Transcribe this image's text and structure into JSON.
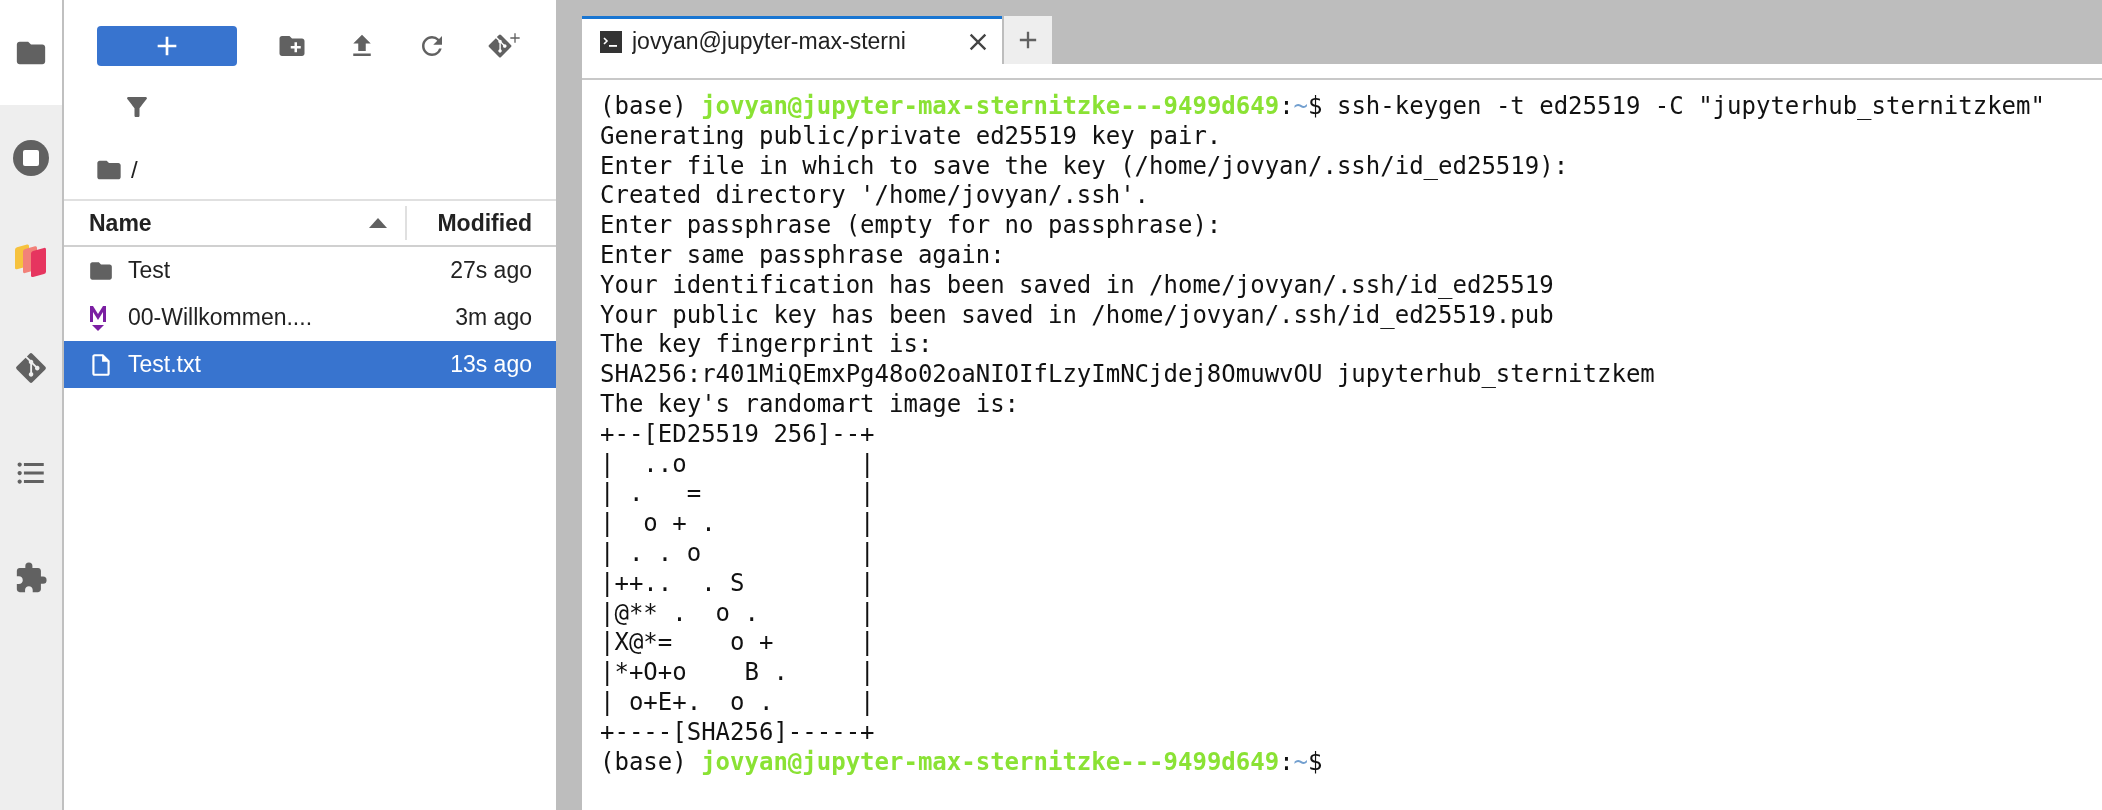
{
  "activity_bar": {
    "items": [
      {
        "kind": "folder",
        "selected": true
      },
      {
        "kind": "running",
        "selected": false
      },
      {
        "kind": "palette",
        "selected": false
      },
      {
        "kind": "git",
        "selected": false
      },
      {
        "kind": "toc",
        "selected": false
      },
      {
        "kind": "extensions",
        "selected": false
      }
    ]
  },
  "file_browser": {
    "toolbar": [
      {
        "kind": "new"
      },
      {
        "kind": "new_folder"
      },
      {
        "kind": "upload"
      },
      {
        "kind": "refresh"
      },
      {
        "kind": "git_clone"
      }
    ],
    "breadcrumb": "/",
    "columns": [
      {
        "label": "Name",
        "sort_ascending": true
      },
      {
        "label": "Modified"
      }
    ],
    "rows": [
      {
        "kind": "folder",
        "name": "Test",
        "modified": "27s ago",
        "selected": false
      },
      {
        "kind": "markdown",
        "name": "00-Willkommen....",
        "modified": "3m ago",
        "selected": false
      },
      {
        "kind": "text",
        "name": "Test.txt",
        "modified": "13s ago",
        "selected": true
      }
    ]
  },
  "tabs": [
    {
      "title": "jovyan@jupyter-max-sterni",
      "selected": true
    }
  ],
  "terminal": {
    "lines": [
      {
        "kind": "prompt",
        "env": "(base)",
        "user_host": "jovyan@jupyter-max-sternitzke---9499d649",
        "separator": ":",
        "path": "~",
        "symbol": "$",
        "command": "ssh-keygen -t ed25519 -C \"jupyterhub_sternitzkem\""
      },
      {
        "kind": "output",
        "text": "Generating public/private ed25519 key pair."
      },
      {
        "kind": "output",
        "text": "Enter file in which to save the key (/home/jovyan/.ssh/id_ed25519):"
      },
      {
        "kind": "output",
        "text": "Created directory '/home/jovyan/.ssh'."
      },
      {
        "kind": "output",
        "text": "Enter passphrase (empty for no passphrase):"
      },
      {
        "kind": "output",
        "text": "Enter same passphrase again:"
      },
      {
        "kind": "output",
        "text": "Your identification has been saved in /home/jovyan/.ssh/id_ed25519"
      },
      {
        "kind": "output",
        "text": "Your public key has been saved in /home/jovyan/.ssh/id_ed25519.pub"
      },
      {
        "kind": "output",
        "text": "The key fingerprint is:"
      },
      {
        "kind": "output",
        "text": "SHA256:r401MiQEmxPg48o02oaNIOIfLzyImNCjdej8OmuwvOU jupyterhub_sternitzkem"
      },
      {
        "kind": "output",
        "text": "The key's randomart image is:"
      },
      {
        "kind": "output",
        "text": "+--[ED25519 256]--+"
      },
      {
        "kind": "output",
        "text": "|  ..o            |"
      },
      {
        "kind": "output",
        "text": "| .   =           |"
      },
      {
        "kind": "output",
        "text": "|  o + .          |"
      },
      {
        "kind": "output",
        "text": "| . . o           |"
      },
      {
        "kind": "output",
        "text": "|++..  . S        |"
      },
      {
        "kind": "output",
        "text": "|@** .  o .       |"
      },
      {
        "kind": "output",
        "text": "|X@*=    o +      |"
      },
      {
        "kind": "output",
        "text": "|*+O+o    B .     |"
      },
      {
        "kind": "output",
        "text": "| o+E+.  o .      |"
      },
      {
        "kind": "output",
        "text": "+----[SHA256]-----+"
      },
      {
        "kind": "prompt",
        "env": "(base)",
        "user_host": "jovyan@jupyter-max-sternitzke---9499d649",
        "separator": ":",
        "path": "~",
        "symbol": "$"
      }
    ]
  }
}
